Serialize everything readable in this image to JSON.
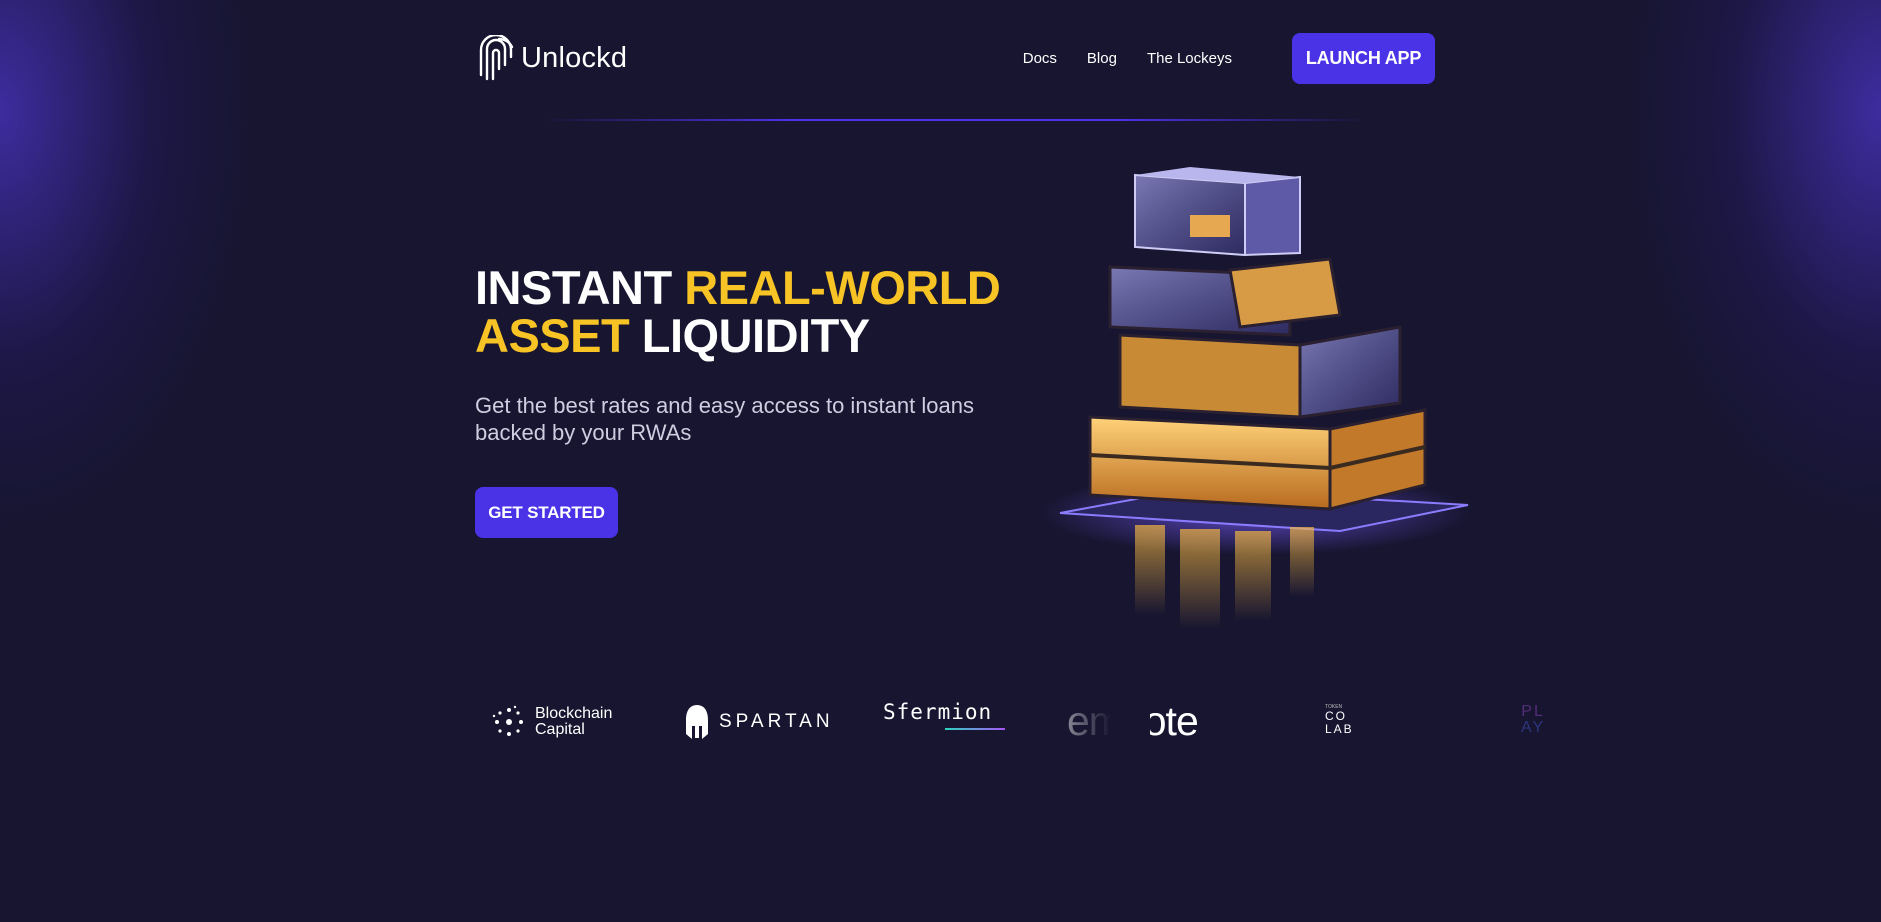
{
  "header": {
    "logo_text": "Unlockd",
    "nav": [
      {
        "label": "Docs"
      },
      {
        "label": "Blog"
      },
      {
        "label": "The Lockeys"
      }
    ],
    "launch_label": "LAUNCH APP"
  },
  "hero": {
    "title_part1": "INSTANT ",
    "title_highlight1": "REAL-WORLD",
    "title_highlight2": "ASSET",
    "title_part2": " LIQUIDITY",
    "subtitle": "Get the best rates and easy access to instant loans backed by your RWAs",
    "cta_label": "GET STARTED"
  },
  "partners": {
    "blockchain_capital_line1": "Blockchain",
    "blockchain_capital_line2": "Capital",
    "spartan": "SPARTAN",
    "sfermion": "Sfermion",
    "emoote": "emoote",
    "colab_small": "TOKEN",
    "colab_line1": "CO",
    "colab_line2": "LAB",
    "partial_line1": "PL",
    "partial_line2": "AY"
  },
  "colors": {
    "background": "#171530",
    "accent": "#4a32e6",
    "highlight": "#f7c325"
  },
  "icons": [
    "unlockd-logo-icon",
    "building-illustration",
    "blockchain-capital-icon",
    "spartan-helmet-icon"
  ]
}
